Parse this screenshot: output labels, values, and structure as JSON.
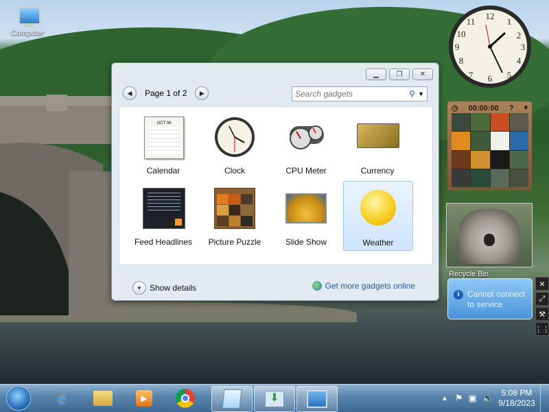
{
  "desktop": {
    "icons": [
      {
        "label": "Computer",
        "icon": "computer-icon"
      },
      {
        "label": "Recycle Bin",
        "icon": "recycle-bin-icon"
      }
    ]
  },
  "gallery": {
    "pager_text": "Page 1 of 2",
    "search_placeholder": "Search gadgets",
    "gadgets": [
      {
        "label": "Calendar",
        "icon": "calendar-icon"
      },
      {
        "label": "Clock",
        "icon": "clock-icon"
      },
      {
        "label": "CPU Meter",
        "icon": "cpu-meter-icon"
      },
      {
        "label": "Currency",
        "icon": "currency-icon"
      },
      {
        "label": "Feed Headlines",
        "icon": "feed-headlines-icon"
      },
      {
        "label": "Picture Puzzle",
        "icon": "picture-puzzle-icon"
      },
      {
        "label": "Slide Show",
        "icon": "slide-show-icon"
      },
      {
        "label": "Weather",
        "icon": "weather-icon",
        "selected": true
      }
    ],
    "calendar_month": "OCT 06",
    "show_details": "Show details",
    "get_more": "Get more gadgets online"
  },
  "side_gadgets": {
    "puzzle_timer": "00:00:00",
    "weather_message": "Cannot connect to service"
  },
  "taskbar": {
    "time": "5:08 PM",
    "date": "9/18/2023",
    "apps": [
      "start-orb-icon",
      "internet-explorer-icon",
      "file-explorer-icon",
      "media-player-icon",
      "chrome-icon",
      "notepad-window-icon",
      "download-window-icon",
      "gadget-window-icon"
    ]
  },
  "colors": {
    "accent": "#1a5ca6",
    "selection": "#cfe5fb",
    "taskbar": "#3d6993"
  }
}
